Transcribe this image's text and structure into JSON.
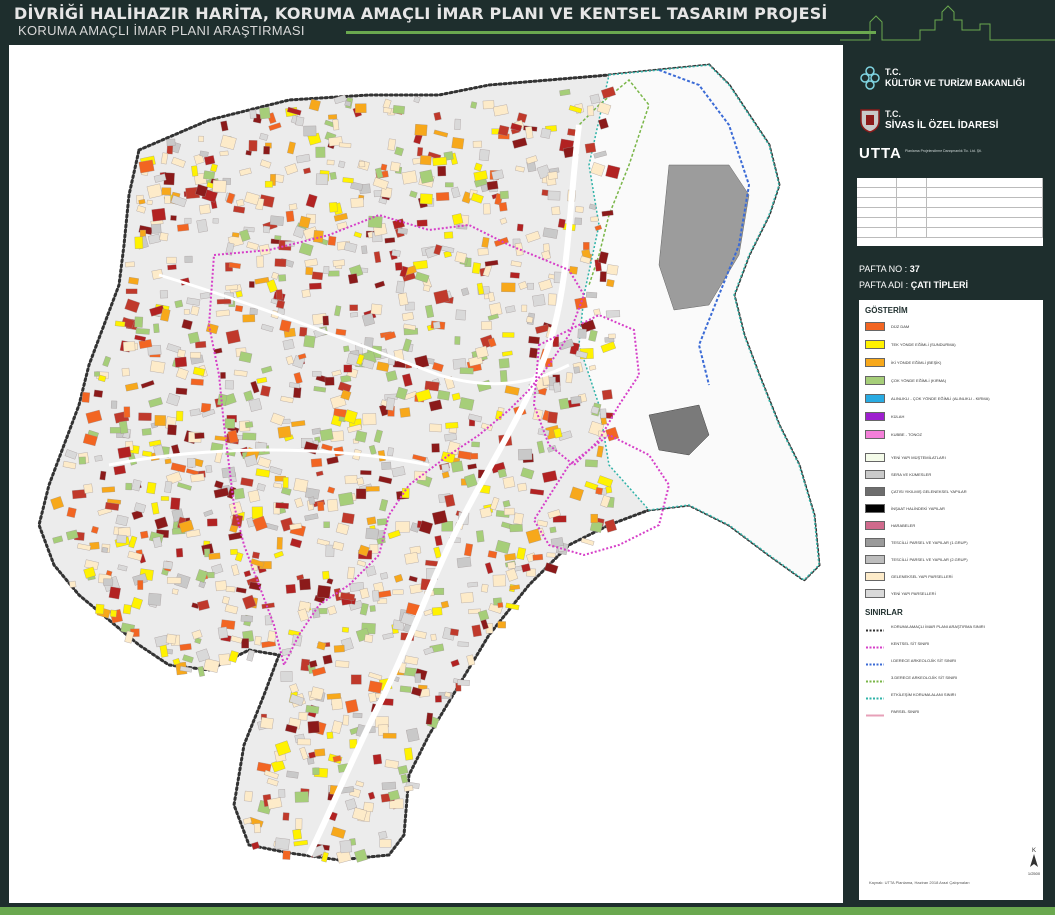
{
  "header": {
    "title": "DİVRİĞİ HALİHAZIR HARİTA, KORUMA AMAÇLI İMAR PLANI VE KENTSEL TASARIM PROJESİ",
    "subtitle": "KORUMA AMAÇLI İMAR PLANI ARAŞTIRMASI"
  },
  "logos": {
    "ministry_prefix": "T.C.",
    "ministry": "KÜLTÜR VE TURİZM BAKANLIĞI",
    "province_prefix": "T.C.",
    "province": "SİVAS İL ÖZEL İDARESİ",
    "utta": "UTTA",
    "utta_sub": "Planlama Projelendirme Danışmanlık Tic. Ltd. Şti."
  },
  "sheet": {
    "pafta_no_label": "PAFTA NO :",
    "pafta_no": "37",
    "pafta_adi_label": "PAFTA ADI :",
    "pafta_adi": "ÇATI TİPLERİ"
  },
  "legend": {
    "title": "GÖSTERİM",
    "roof_items": [
      {
        "label": "DÜZ DAM",
        "color": "#f26522"
      },
      {
        "label": "TEK YÖNDE EĞİMLİ (SUNDURMA)",
        "color": "#fff200"
      },
      {
        "label": "İKİ YÖNDE EĞİMLİ (BEŞİK)",
        "color": "#f7a81b"
      },
      {
        "label": "ÇOK YÖNDE EĞİMLİ (KIRMA)",
        "color": "#a6ce79"
      },
      {
        "label": "ALINLIKLI - ÇOK YÖNDE EĞİMLİ (ALINLIKLI - KIRMA)",
        "color": "#29abe2"
      },
      {
        "label": "KÜLAH",
        "color": "#9e1fcf"
      },
      {
        "label": "KUBBE - TONOZ",
        "color": "#f47fd9"
      }
    ],
    "other_items": [
      {
        "label": "YENİ YAPI MÜŞTEMİLATLARI",
        "color": "#f4fbe9"
      },
      {
        "label": "SERA VE KÜMESLER",
        "color": "#c9c9c9"
      },
      {
        "label": "ÇATISI YIKILMIŞ GELENEKSEL YAPILAR",
        "color": "#6d6d6d"
      },
      {
        "label": "İNŞAAT HALİNDEKİ YAPILAR",
        "color": "#000000"
      },
      {
        "label": "HARABELER",
        "color": "#d06a8c"
      },
      {
        "label": "TESCİLLİ PARSEL VE YAPILAR (1.GRUP)",
        "color": "#9a9a9a"
      },
      {
        "label": "TESCİLLİ PARSEL VE YAPILAR (2.GRUP)",
        "color": "#bdbdbd"
      },
      {
        "label": "GELENEKSEL YAPI PARSELLERİ",
        "color": "#fdebc9"
      },
      {
        "label": "YENİ YAPI PARSELLERİ",
        "color": "#d9d9d9"
      }
    ],
    "boundaries_title": "SINIRLAR",
    "boundary_items": [
      {
        "label": "KORUMA AMAÇLI İMAR PLANI ARAŞTIRMA SINIRI",
        "color": "#333333"
      },
      {
        "label": "KENTSEL SİT SINIRI",
        "color": "#d63fc8"
      },
      {
        "label": "I.DERECE ARKEOLOJİK SİT SINIRI",
        "color": "#3b6bd6"
      },
      {
        "label": "3.DERECE ARKEOLOJİK SİT SINIRI",
        "color": "#7ab648"
      },
      {
        "label": "ETKİLEŞİM KORUMA ALANI SINIRI",
        "color": "#2fb3a8"
      },
      {
        "label": "PARSEL SINIRI",
        "color": "#e7a0b8"
      }
    ],
    "scale": "1/2500",
    "credit": "Kaynak: UTTA Planlama, Haziran 2018 Arazi Çalışmaları"
  }
}
